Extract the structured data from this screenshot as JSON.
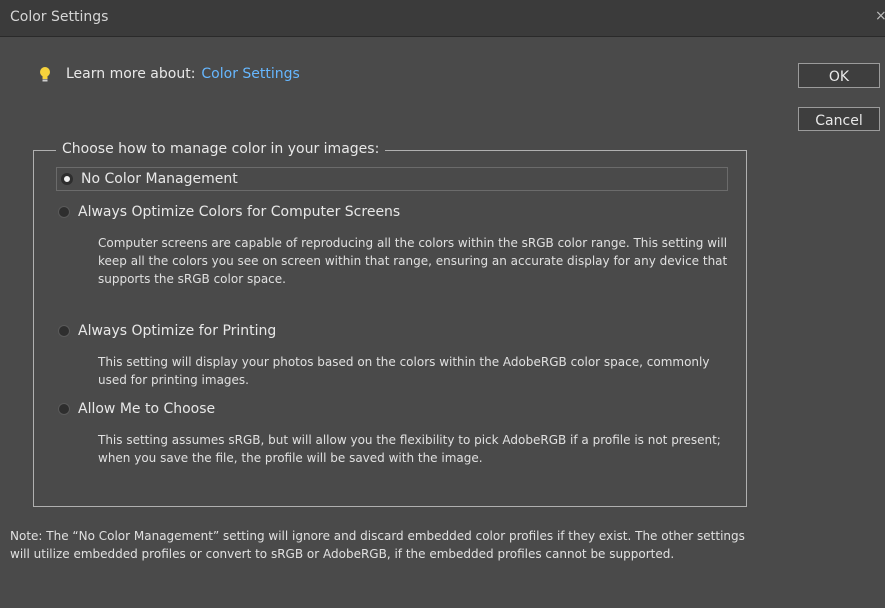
{
  "window": {
    "title": "Color Settings",
    "close_glyph": "×"
  },
  "learn_more": {
    "prefix": "Learn more about:",
    "link": "Color Settings",
    "icon": "lightbulb-icon"
  },
  "buttons": {
    "ok": "OK",
    "cancel": "Cancel"
  },
  "group": {
    "legend": "Choose how to manage color in your images:",
    "options": [
      {
        "label": "No Color Management",
        "selected": true,
        "description": ""
      },
      {
        "label": "Always Optimize Colors for Computer Screens",
        "selected": false,
        "description": "Computer screens are capable of reproducing all the colors within the sRGB color range. This setting will keep all the colors you see on screen within that range, ensuring an accurate display for any device that supports the sRGB color space."
      },
      {
        "label": "Always Optimize for Printing",
        "selected": false,
        "description": "This setting will display your photos based on the colors within the AdobeRGB color space, commonly used for printing images."
      },
      {
        "label": "Allow Me to Choose",
        "selected": false,
        "description": "This setting assumes sRGB, but will allow you the flexibility to pick AdobeRGB if a profile is not present; when you save the file, the profile will be saved with the image."
      }
    ]
  },
  "note": "Note: The “No Color Management” setting will ignore and discard embedded color profiles if they exist. The other settings will utilize embedded profiles or convert to sRGB or AdobeRGB, if the embedded profiles cannot be supported.",
  "colors": {
    "background": "#4a4a4a",
    "link": "#66b7ff",
    "titlebar": "#3b3b3b"
  }
}
